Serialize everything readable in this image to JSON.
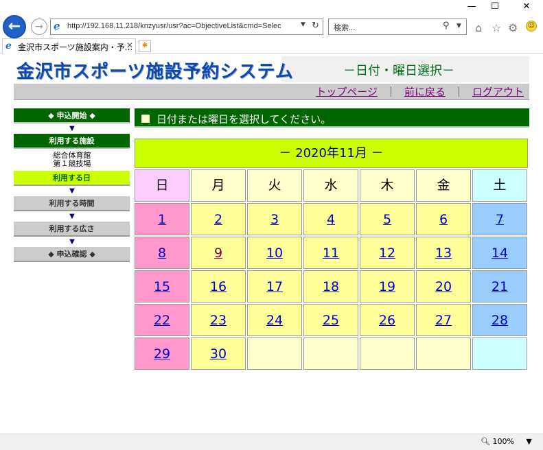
{
  "browser": {
    "address": "http://192.168.11.218/knzyusr/usr?ac=ObjectiveList&cmd=Selec",
    "search_placeholder": "検索...",
    "tab_title": "金沢市スポーツ施設案内・予...",
    "zoom": "100%",
    "controls": {
      "minimize": "—",
      "maximize": "☐",
      "close": "✕"
    }
  },
  "header": {
    "logo": "金沢市スポーツ施設予約システム",
    "subtitle": "－日付・曜日選択－"
  },
  "nav": {
    "top_page": "トップページ",
    "back": "前に戻る",
    "logout": "ログアウト",
    "separator": "｜"
  },
  "sidebar": {
    "apply_start": "◆ 申込開始 ◆",
    "facility_label": "利用する施設",
    "facility_name_1": "総合体育館",
    "facility_name_2": "第１競技場",
    "date_label": "利用する日",
    "time_label": "利用する時間",
    "area_label": "利用する広さ",
    "confirm_label": "◆ 申込確認 ◆",
    "arrow": "▼"
  },
  "main": {
    "instruction": "日付または曜日を選択してください。",
    "calendar_title": "－ 2020年11月 －",
    "weekdays": [
      "日",
      "月",
      "火",
      "水",
      "木",
      "金",
      "土"
    ],
    "weeks": [
      [
        "1",
        "2",
        "3",
        "4",
        "5",
        "6",
        "7"
      ],
      [
        "8",
        "9",
        "10",
        "11",
        "12",
        "13",
        "14"
      ],
      [
        "15",
        "16",
        "17",
        "18",
        "19",
        "20",
        "21"
      ],
      [
        "22",
        "23",
        "24",
        "25",
        "26",
        "27",
        "28"
      ],
      [
        "29",
        "30",
        "",
        "",
        "",
        "",
        ""
      ]
    ]
  },
  "colors": {
    "header_green": "#006600",
    "lime": "#ccff00",
    "sunday": "#ff99cc",
    "weekday": "#ffff99",
    "saturday": "#99ccff"
  }
}
